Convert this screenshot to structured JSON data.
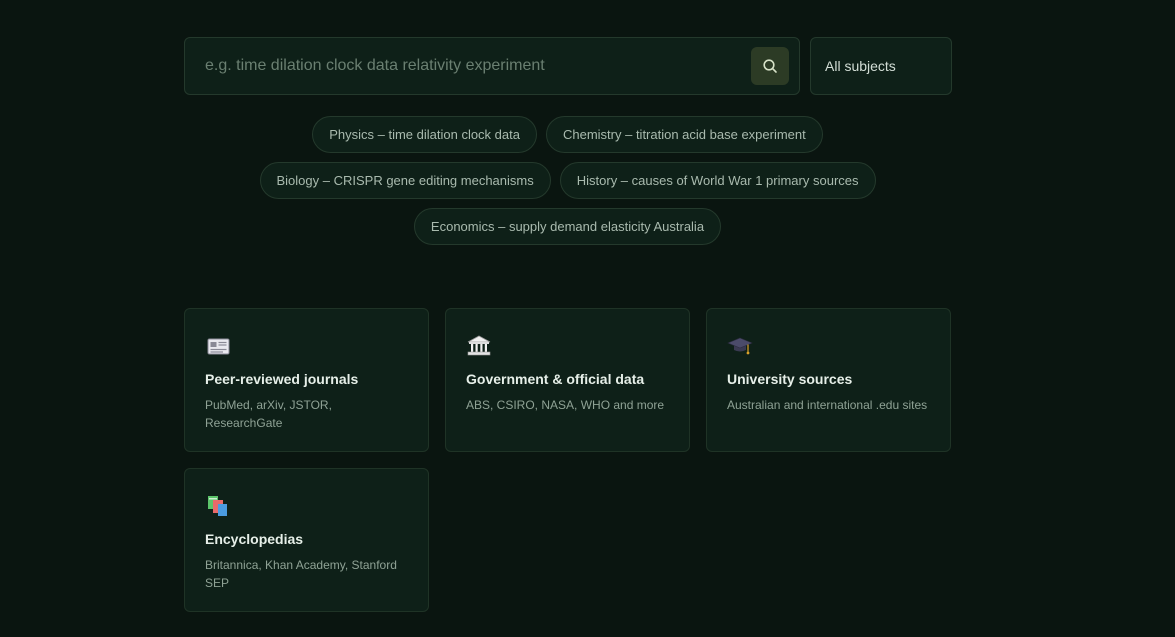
{
  "search": {
    "placeholder": "e.g. time dilation clock data relativity experiment",
    "value": "",
    "button_icon": "search-icon"
  },
  "subject_filter": {
    "selected": "All subjects"
  },
  "suggestions": [
    [
      "Physics – time dilation clock data",
      "Chemistry – titration acid base experiment"
    ],
    [
      "Biology – CRISPR gene editing mechanisms",
      "History – causes of World War 1 primary sources"
    ],
    [
      "Economics – supply demand elasticity Australia"
    ]
  ],
  "sources": [
    {
      "icon": "newspaper-icon",
      "title": "Peer-reviewed journals",
      "description": "PubMed, arXiv, JSTOR, ResearchGate"
    },
    {
      "icon": "government-building-icon",
      "title": "Government & official data",
      "description": "ABS, CSIRO, NASA, WHO and more"
    },
    {
      "icon": "graduation-cap-icon",
      "title": "University sources",
      "description": "Australian and international .edu sites"
    },
    {
      "icon": "books-icon",
      "title": "Encyclopedias",
      "description": "Britannica, Khan Academy, Stanford SEP"
    }
  ],
  "colors": {
    "background": "#0a1510",
    "surface": "#0e2018",
    "border": "#24392c",
    "search_button": "#2c3b25",
    "text_primary": "#e6efe8",
    "text_muted": "#8fa295"
  }
}
